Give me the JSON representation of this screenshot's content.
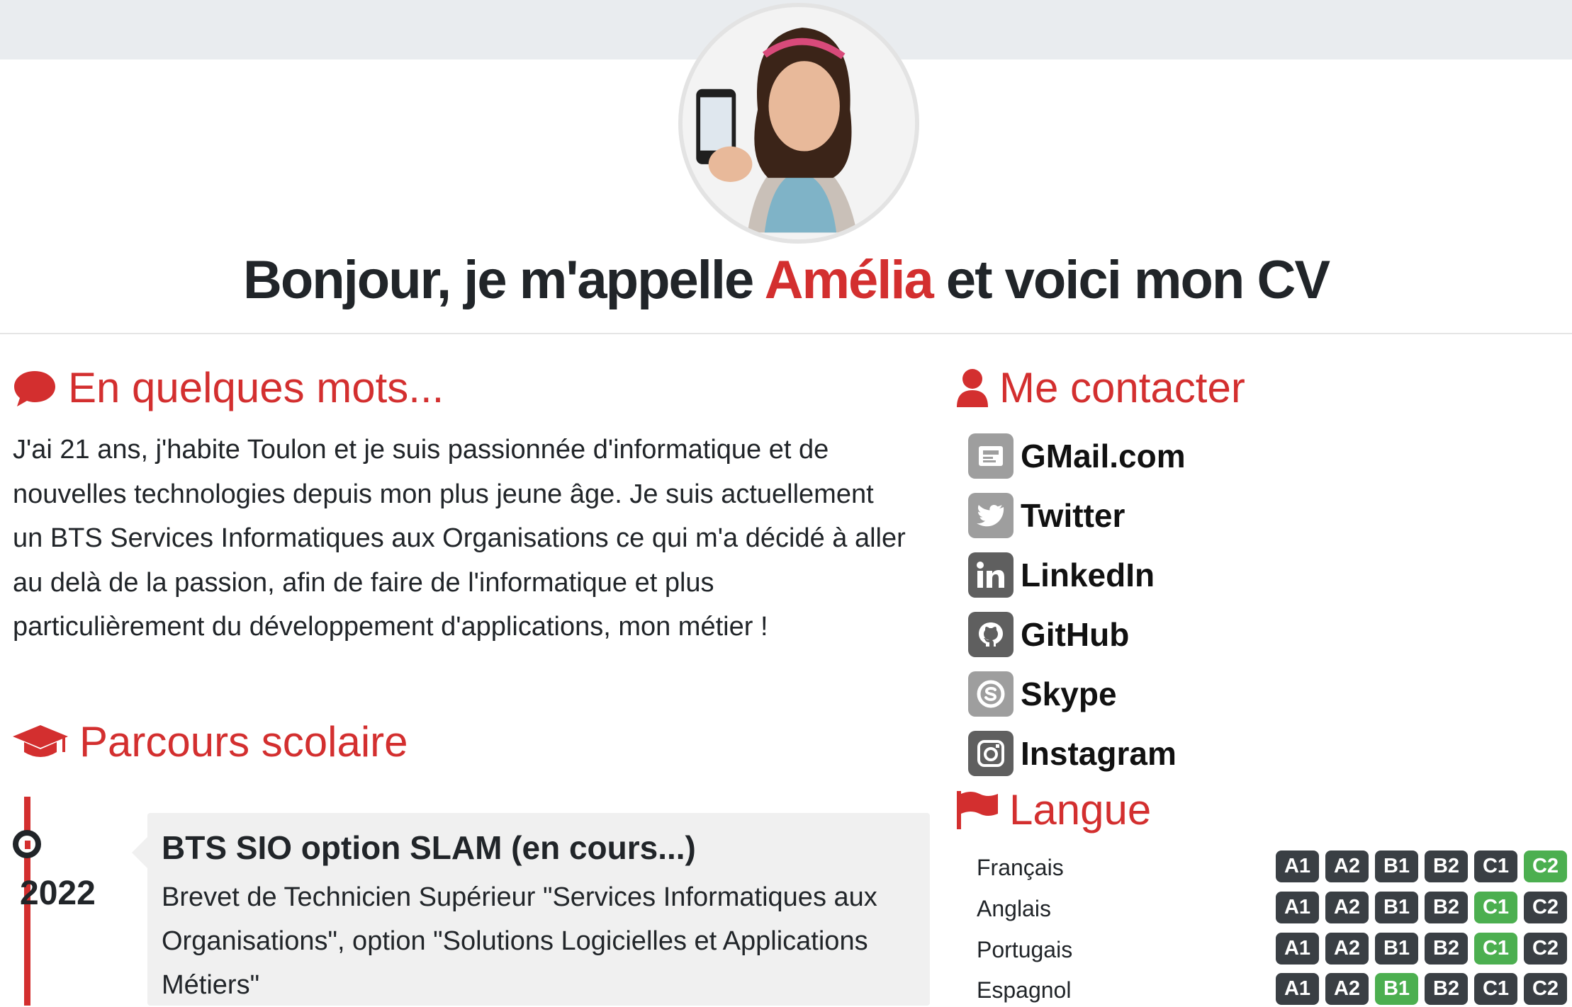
{
  "hero": {
    "title_prefix": "Bonjour, je m'appelle ",
    "name": "Amélia",
    "title_suffix": " et voici mon CV"
  },
  "about": {
    "title": "En quelques mots...",
    "icon": "comment-icon",
    "text": "J'ai 21 ans, j'habite Toulon et je suis passionnée d'informatique et de nouvelles technologies depuis mon plus jeune âge. Je suis actuellement un BTS Services Informatiques aux Organisations ce qui m'a décidé à aller au delà de la passion, afin de faire de l'informatique et plus particulièrement du développement d'applications, mon métier !"
  },
  "education": {
    "title": "Parcours scolaire",
    "icon": "graduation-cap-icon",
    "items": [
      {
        "year": "2022",
        "title": "BTS SIO option SLAM (en cours...)",
        "text": "Brevet de Technicien Supérieur \"Services Informatiques aux Organisations\", option \"Solutions Logicielles et Applications Métiers\""
      }
    ]
  },
  "contact": {
    "title": "Me contacter",
    "icon": "user-icon",
    "items": [
      {
        "label": "GMail.com",
        "icon": "gmail-icon"
      },
      {
        "label": "Twitter",
        "icon": "twitter-icon"
      },
      {
        "label": "LinkedIn",
        "icon": "linkedin-icon"
      },
      {
        "label": "GitHub",
        "icon": "github-icon"
      },
      {
        "label": "Skype",
        "icon": "skype-icon"
      },
      {
        "label": "Instagram",
        "icon": "instagram-icon"
      }
    ]
  },
  "languages": {
    "title": "Langue",
    "icon": "flag-icon",
    "levels": [
      "A1",
      "A2",
      "B1",
      "B2",
      "C1",
      "C2"
    ],
    "items": [
      {
        "name": "Français",
        "level": "C2"
      },
      {
        "name": "Anglais",
        "level": "C1"
      },
      {
        "name": "Portugais",
        "level": "C1"
      },
      {
        "name": "Espagnol",
        "level": "B1"
      }
    ]
  },
  "colors": {
    "accent": "#d32f2f",
    "level_active": "#4caf50",
    "level_inactive": "#3a3f44",
    "text": "#212529"
  }
}
